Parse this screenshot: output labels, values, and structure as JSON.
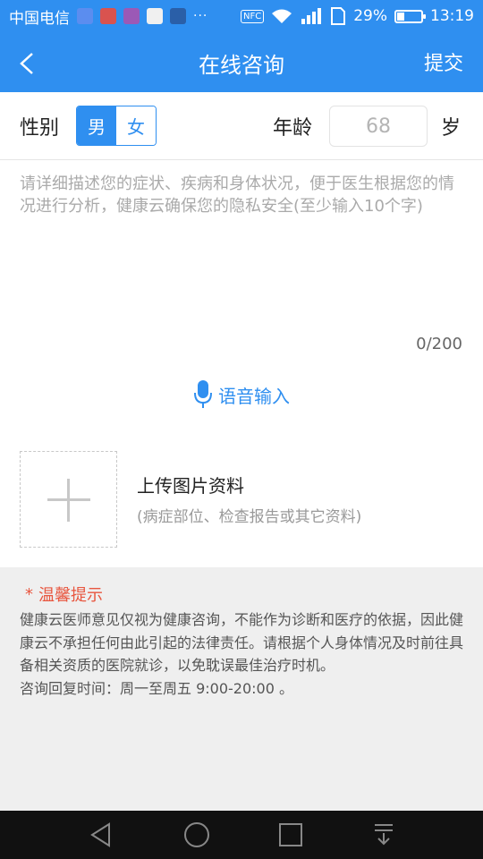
{
  "status_bar": {
    "carrier": "中国电信",
    "overflow": "···",
    "nfc": "NFC",
    "battery": "29%",
    "time": "13:19"
  },
  "navbar": {
    "title": "在线咨询",
    "submit_label": "提交"
  },
  "form": {
    "gender_label": "性别",
    "gender_male": "男",
    "gender_female": "女",
    "gender_selected": "男",
    "age_label": "年龄",
    "age_placeholder": "68",
    "age_unit": "岁",
    "description_placeholder": "请详细描述您的症状、疾病和身体状况，便于医生根据您的情况进行分析，健康云确保您的隐私安全(至少输入10个字)",
    "char_counter": "0/200",
    "voice_input_label": "语音输入",
    "upload_title": "上传图片资料",
    "upload_subtitle": "(病症部位、检查报告或其它资料)"
  },
  "tips": {
    "star": "*",
    "title": "温馨提示",
    "body": "健康云医师意见仅视为健康咨询，不能作为诊断和医疗的依据，因此健康云不承担任何由此引起的法律责任。请根据个人身体情况及时前往具备相关资质的医院就诊，以免耽误最佳治疗时机。",
    "hours": "咨询回复时间：周一至周五 9:00-20:00 。"
  },
  "colors": {
    "primary": "#2f8ff0",
    "warning": "#e8563f",
    "tips_bg": "#efefef"
  },
  "icons": [
    "back-arrow-icon",
    "microphone-icon",
    "plus-icon",
    "nav-back-triangle-icon",
    "nav-home-circle-icon",
    "nav-recent-square-icon",
    "nav-dropdown-icon"
  ]
}
